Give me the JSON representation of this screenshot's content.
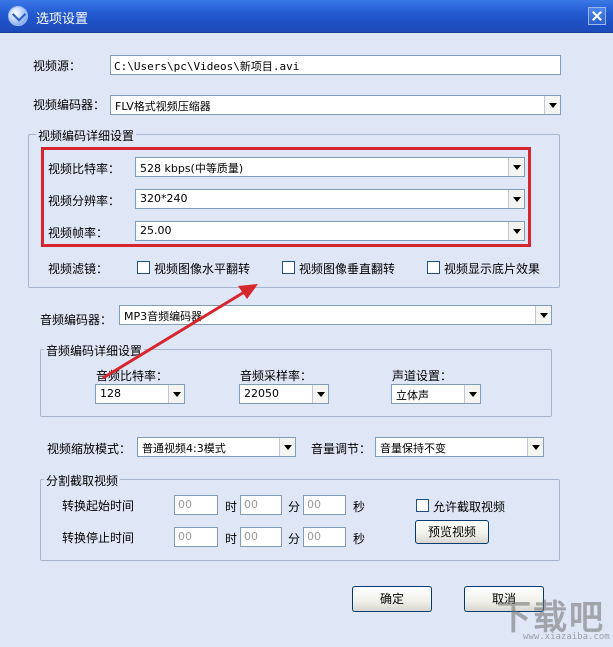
{
  "window": {
    "title": "选项设置"
  },
  "video_source": {
    "label": "视频源：",
    "value": "C:\\Users\\pc\\Videos\\新项目.avi"
  },
  "video_encoder": {
    "label": "视频编码器：",
    "value": "FLV格式视频压缩器"
  },
  "video_detail": {
    "group_title": "视频编码详细设置",
    "bitrate": {
      "label": "视频比特率：",
      "value": "528 kbps(中等质量)"
    },
    "resolution": {
      "label": "视频分辨率：",
      "value": "320*240"
    },
    "framerate": {
      "label": "视频帧率：",
      "value": "25.00"
    },
    "filter_label": "视频滤镜：",
    "filters": [
      {
        "label": "视频图像水平翻转",
        "checked": false
      },
      {
        "label": "视频图像垂直翻转",
        "checked": false
      },
      {
        "label": "视频显示底片效果",
        "checked": false
      }
    ]
  },
  "audio_encoder": {
    "label": "音频编码器：",
    "value": "MP3音频编码器"
  },
  "audio_detail": {
    "group_title": "音频编码详细设置",
    "bitrate": {
      "label": "音频比特率：",
      "value": "128"
    },
    "samplerate": {
      "label": "音频采样率：",
      "value": "22050"
    },
    "channel": {
      "label": "声道设置：",
      "value": "立体声"
    }
  },
  "scale_mode": {
    "label": "视频缩放模式：",
    "value": "普通视频4:3模式"
  },
  "volume": {
    "label": "音量调节：",
    "value": "音量保持不变"
  },
  "split": {
    "group_title": "分割截取视频",
    "start_label": "转换起始时间",
    "stop_label": "转换停止时间",
    "start": {
      "h": "00",
      "m": "00",
      "s": "00"
    },
    "stop": {
      "h": "00",
      "m": "00",
      "s": "00"
    },
    "unit_h": "时",
    "unit_m": "分",
    "unit_s": "秒",
    "allow_label": "允许截取视频",
    "preview_label": "预览视频"
  },
  "buttons": {
    "ok": "确定",
    "cancel": "取消"
  },
  "watermark": {
    "text": "下载吧",
    "sub": "www.xiazaiba.com"
  },
  "colors": {
    "highlight": "#d6262e",
    "titlebar": "#2258d0",
    "background": "#dfe7f7"
  }
}
